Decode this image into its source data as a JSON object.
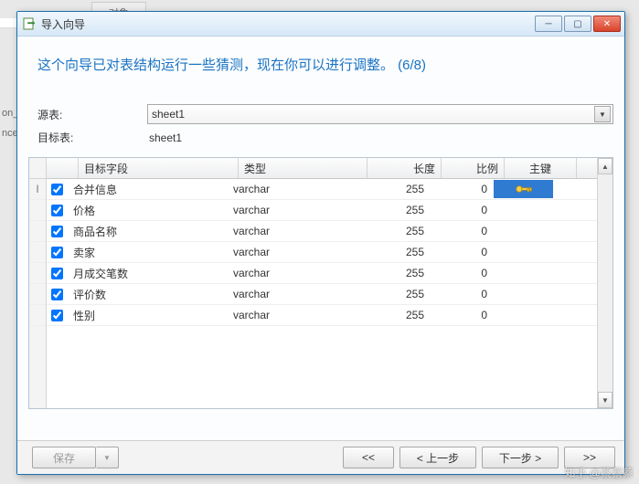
{
  "bg": {
    "tab": "对象"
  },
  "titlebar": {
    "text": "导入向导"
  },
  "description": "这个向导已对表结构运行一些猜测，现在你可以进行调整。 (6/8)",
  "form": {
    "source_label": "源表:",
    "source_value": "sheet1",
    "target_label": "目标表:",
    "target_value": "sheet1"
  },
  "columns": {
    "field": "目标字段",
    "type": "类型",
    "length": "长度",
    "scale": "比例",
    "pk": "主键"
  },
  "rows": [
    {
      "checked": true,
      "field": "合并信息",
      "type": "varchar",
      "length": "255",
      "scale": "0",
      "is_pk": true,
      "cursor": true
    },
    {
      "checked": true,
      "field": "价格",
      "type": "varchar",
      "length": "255",
      "scale": "0",
      "is_pk": false
    },
    {
      "checked": true,
      "field": "商品名称",
      "type": "varchar",
      "length": "255",
      "scale": "0",
      "is_pk": false
    },
    {
      "checked": true,
      "field": "卖家",
      "type": "varchar",
      "length": "255",
      "scale": "0",
      "is_pk": false
    },
    {
      "checked": true,
      "field": "月成交笔数",
      "type": "varchar",
      "length": "255",
      "scale": "0",
      "is_pk": false
    },
    {
      "checked": true,
      "field": "评价数",
      "type": "varchar",
      "length": "255",
      "scale": "0",
      "is_pk": false
    },
    {
      "checked": true,
      "field": "性别",
      "type": "varchar",
      "length": "255",
      "scale": "0",
      "is_pk": false
    }
  ],
  "footer": {
    "save": "保存",
    "first": "<<",
    "prev": "< 上一步",
    "next": "下一步 >",
    "last": ">>"
  },
  "watermark": "知乎 @蔡蔡蔡"
}
